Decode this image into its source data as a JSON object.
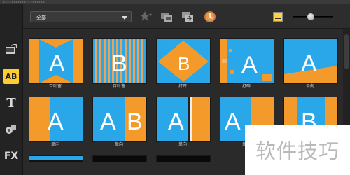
{
  "toolbar": {
    "category": "全部",
    "icons": [
      "favorite-add-icon",
      "import-icon",
      "export-icon",
      "clock-icon",
      "list-view-icon"
    ]
  },
  "sidebar": {
    "items": [
      {
        "name": "media-icon"
      },
      {
        "name": "transition-icon",
        "label": "AB"
      },
      {
        "name": "title-icon",
        "label": "T"
      },
      {
        "name": "graphics-icon"
      },
      {
        "name": "filter-icon",
        "label": "FX"
      }
    ]
  },
  "grid": {
    "rows": [
      [
        "百叶窗",
        "百叶窗",
        "打开",
        "打碎",
        "单向"
      ],
      [
        "单向",
        "单向",
        "单向",
        "单向",
        "单向"
      ]
    ]
  },
  "zoom": {
    "level": 0.45
  },
  "watermark": "软件技巧"
}
